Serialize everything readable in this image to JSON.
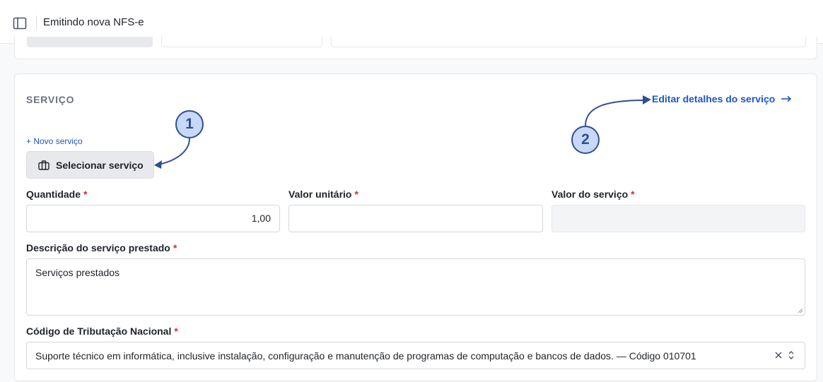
{
  "header": {
    "title": "Emitindo nova NFS-e",
    "sidebar_toggle_icon": "sidebar-panel-icon"
  },
  "service_section": {
    "title": "SERVIÇO",
    "edit_link": "Editar detalhes do serviço",
    "edit_link_icon": "arrow-right-icon",
    "new_service": "+ Novo serviço",
    "select_button": "Selecionar serviço",
    "select_button_icon": "briefcase-icon"
  },
  "fields": {
    "quantity": {
      "label": "Quantidade",
      "required": "*",
      "value": "1,00"
    },
    "unit_value": {
      "label": "Valor unitário",
      "required": "*",
      "value": ""
    },
    "service_value": {
      "label": "Valor do serviço",
      "required": "*",
      "value": ""
    },
    "description": {
      "label": "Descrição do serviço prestado",
      "required": "*",
      "value": "Serviços prestados"
    },
    "tax_code": {
      "label": "Código de Tributação Nacional",
      "required": "*",
      "value": "Suporte técnico em informática, inclusive instalação, configuração e manutenção de programas de computação e bancos de dados. — Código 010701",
      "clear_icon": "close-icon",
      "chevron_icon": "chevron-up-down-icon"
    }
  },
  "annotations": [
    {
      "number": "1"
    },
    {
      "number": "2"
    }
  ],
  "colors": {
    "accent": "#1f56c5",
    "required": "#d92c2c",
    "callout_fill": "#c7d8f8",
    "callout_stroke": "#2f4f8f"
  }
}
